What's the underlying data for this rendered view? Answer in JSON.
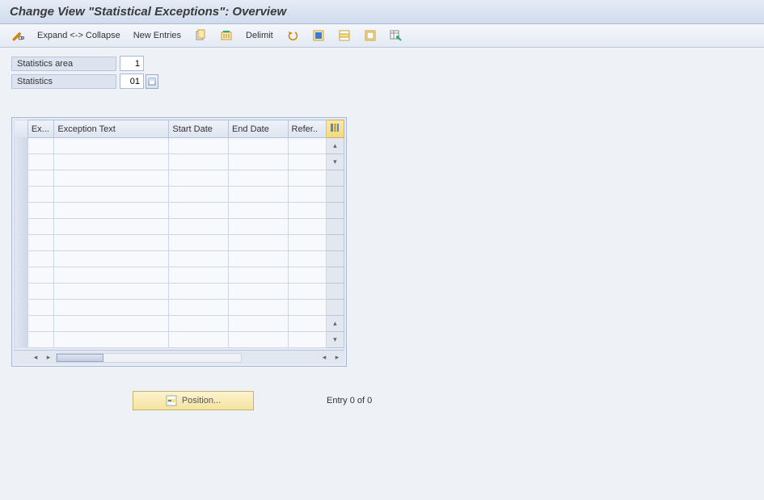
{
  "header": {
    "title": "Change View \"Statistical Exceptions\": Overview"
  },
  "toolbar": {
    "expand_collapse_label": "Expand <-> Collapse",
    "new_entries_label": "New Entries",
    "delimit_label": "Delimit"
  },
  "fields": {
    "stat_area_label": "Statistics area",
    "stat_area_value": "1",
    "statistics_label": "Statistics",
    "statistics_value": "01"
  },
  "table": {
    "columns": {
      "ex": "Ex...",
      "exception_text": "Exception Text",
      "start_date": "Start Date",
      "end_date": "End Date",
      "refer": "Refer.."
    },
    "row_count": 13
  },
  "footer": {
    "position_label": "Position...",
    "entry_text": "Entry 0 of 0"
  }
}
